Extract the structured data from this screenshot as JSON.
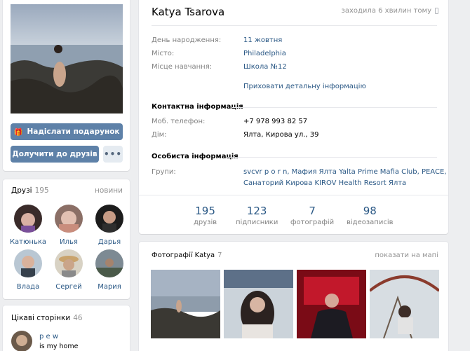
{
  "profile": {
    "name": "Katya Tsarova",
    "last_seen": "заходила 6 хвилин тому",
    "gift_button": "Надіслати подарунок",
    "add_friend_button": "Долучити до друзів",
    "more_button": "•••"
  },
  "info": {
    "birthday_label": "День народження:",
    "birthday_value": "11 жовтня",
    "city_label": "Місто:",
    "city_value": "Philadelphia",
    "school_label": "Місце навчання:",
    "school_value": "Школа №12",
    "hide_details": "Приховати детальну інформацію",
    "contact_title": "Контактна інформація",
    "phone_label": "Моб. телефон:",
    "phone_value": "+7 978 993 82 57",
    "home_label": "Дім:",
    "home_value": "Ялта, Кирова ул., 39",
    "personal_title": "Особиста інформація",
    "groups_label": "Групи:",
    "groups_line1": "svcvr p o r n, Мафия Ялта Yalta Prime Mafia Club, PEACE,",
    "groups_line2": "Санаторий Кирова KIROV Health Resort Ялта"
  },
  "stats": [
    {
      "num": "195",
      "label": "друзів"
    },
    {
      "num": "123",
      "label": "підписники"
    },
    {
      "num": "7",
      "label": "фотографій"
    },
    {
      "num": "98",
      "label": "відеозаписів"
    }
  ],
  "friends": {
    "title": "Друзі",
    "count": "195",
    "link": "новини",
    "items": [
      {
        "name": "Катюнька"
      },
      {
        "name": "Илья"
      },
      {
        "name": "Дарья"
      },
      {
        "name": "Влада"
      },
      {
        "name": "Сергей"
      },
      {
        "name": "Мария"
      }
    ]
  },
  "pages": {
    "title": "Цікаві сторінки",
    "count": "46",
    "items": [
      {
        "name": "p e w",
        "desc": "is my home"
      }
    ]
  },
  "photos": {
    "title": "Фотографії Katya",
    "count": "7",
    "map_link": "показати на мапі"
  },
  "colors": {
    "accent": "#5e81a8",
    "link": "#2a5885",
    "muted": "#828282"
  }
}
